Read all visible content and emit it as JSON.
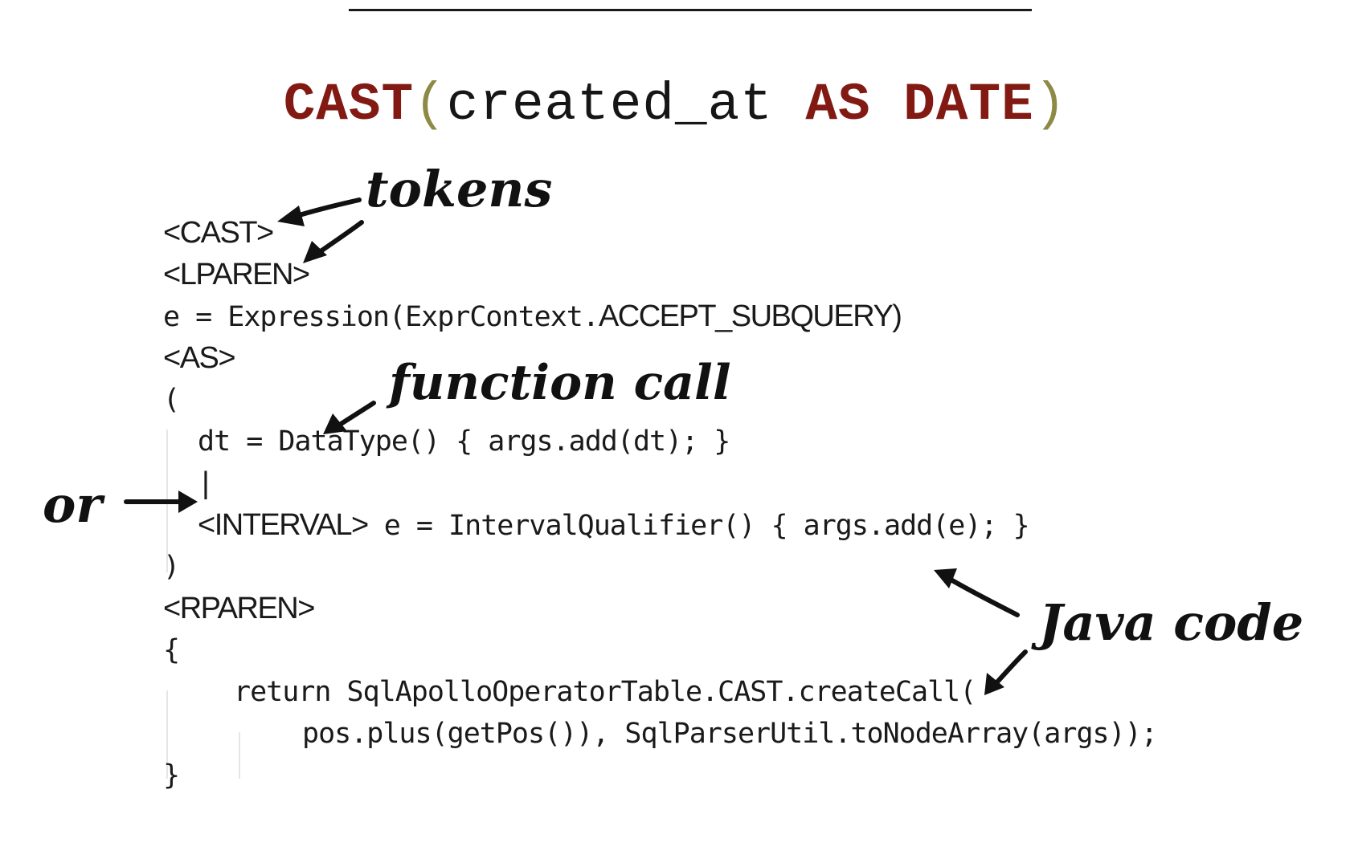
{
  "title": {
    "kw_cast": "CAST",
    "lparen": "(",
    "ident": "created_at",
    "kw_as": "AS",
    "kw_date": "DATE",
    "rparen": ")"
  },
  "code": {
    "l1": "<CAST>",
    "l2": "<LPAREN>",
    "l3_prefix": "e = Expression(ExprContext.",
    "l3_suffix": "ACCEPT_SUBQUERY)",
    "l4": "<AS>",
    "l5": "(",
    "l6": "dt = DataType() { args.add(dt); }",
    "l7": "|",
    "l8_token": "<INTERVAL>",
    "l8_rest": " e = IntervalQualifier() { args.add(e); }",
    "l9": ")",
    "l10": "<RPAREN>",
    "l11": "{",
    "l12": "return SqlApolloOperatorTable.CAST.createCall(",
    "l13": "pos.plus(getPos()), SqlParserUtil.toNodeArray(args));",
    "l14": "}"
  },
  "annotations": {
    "tokens": "tokens",
    "function_call": "function call",
    "or": "or",
    "java_code": "Java code"
  },
  "colors": {
    "keyword": "#821a13",
    "paren": "#8e8a45",
    "text": "#141414"
  }
}
